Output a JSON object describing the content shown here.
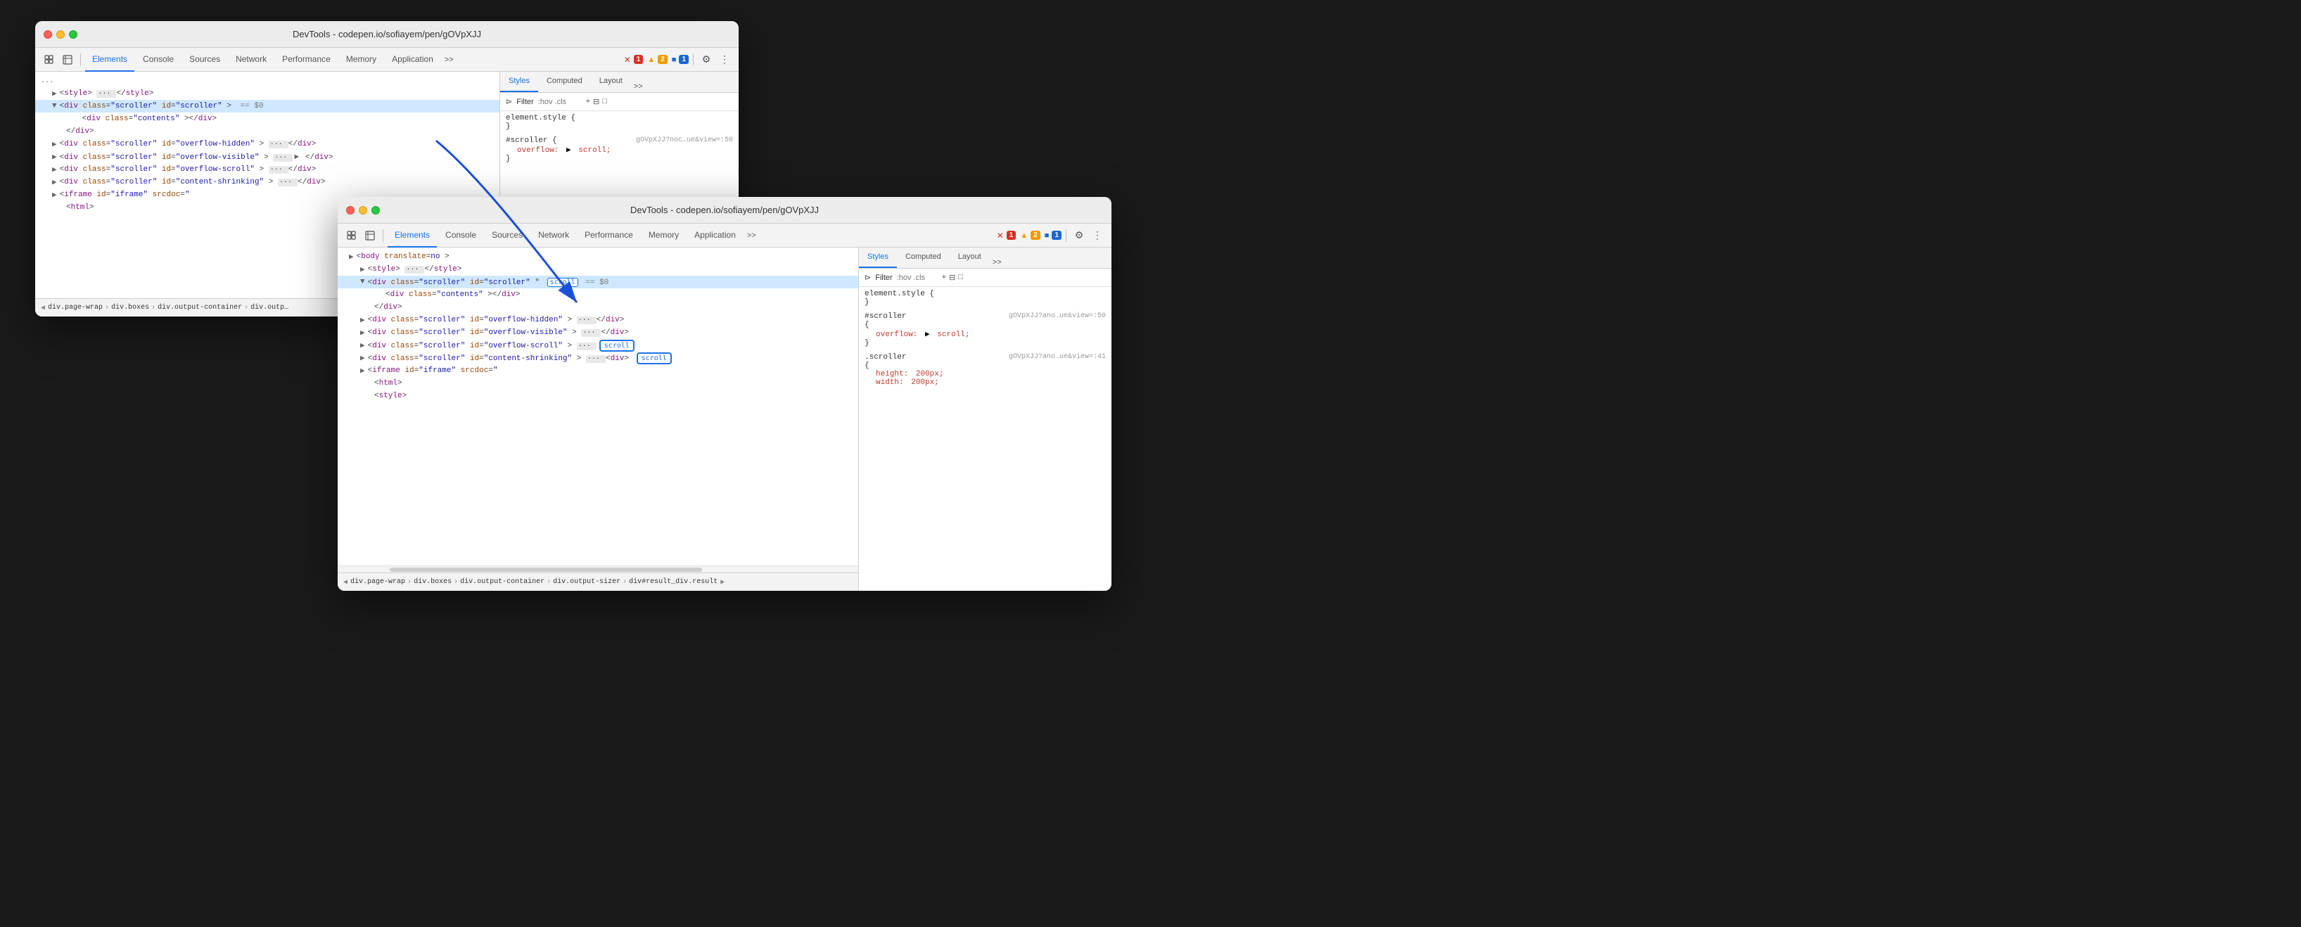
{
  "window1": {
    "title": "DevTools - codepen.io/sofiayem/pen/gOVpXJJ",
    "toolbar": {
      "tabs": [
        "Elements",
        "Console",
        "Sources",
        "Network",
        "Performance",
        "Memory",
        "Application"
      ],
      "active_tab": "Elements",
      "more_label": ">>",
      "badges": {
        "error": "1",
        "warning": "2",
        "info": "1"
      }
    },
    "elements": {
      "rows": [
        {
          "indent": 0,
          "content": "<style> ··· </style>",
          "selected": false
        },
        {
          "indent": 1,
          "content": "<div class=\"scroller\" id=\"scroller\"> == $0",
          "selected": true
        },
        {
          "indent": 2,
          "content": "<div class=\"contents\"></div>",
          "selected": false
        },
        {
          "indent": 1,
          "content": "</div>",
          "selected": false
        },
        {
          "indent": 1,
          "content": "<div class=\"scroller\" id=\"overflow-hidden\"> ··· </div>",
          "selected": false
        },
        {
          "indent": 1,
          "content": "<div class=\"scroller\" id=\"overflow-visible\"> ··· </div>",
          "selected": false
        },
        {
          "indent": 1,
          "content": "<div class=\"scroller\" id=\"overflow-scroll\"> ··· </div>",
          "selected": false
        },
        {
          "indent": 1,
          "content": "<div class=\"scroller\" id=\"content-shrinking\"> ··· </div>",
          "selected": false
        },
        {
          "indent": 1,
          "content": "<iframe id=\"iframe\" srcdoc=\"",
          "selected": false
        },
        {
          "indent": 2,
          "content": "<html>",
          "selected": false
        }
      ]
    },
    "styles": {
      "tabs": [
        "Styles",
        "Computed",
        "Layout"
      ],
      "active_tab": "Styles",
      "filter_placeholder": ":hov .cls",
      "rules": [
        {
          "selector": "element.style {",
          "source": "",
          "properties": [],
          "close": "}"
        },
        {
          "selector": "#scroller {",
          "source": "gOVpXJJ?noc…ue&view=:50",
          "properties": [
            {
              "name": "overflow:",
              "arrow": "▶",
              "value": "scroll;"
            }
          ],
          "close": "}"
        }
      ]
    },
    "breadcrumb": {
      "items": [
        "div.page-wrap",
        "div.boxes",
        "div.output-container",
        "div.outp…"
      ]
    }
  },
  "window2": {
    "title": "DevTools - codepen.io/sofiayem/pen/gOVpXJJ",
    "toolbar": {
      "tabs": [
        "Elements",
        "Console",
        "Sources",
        "Network",
        "Performance",
        "Memory",
        "Application"
      ],
      "active_tab": "Elements",
      "more_label": ">>",
      "badges": {
        "error": "1",
        "warning": "2",
        "info": "1"
      }
    },
    "elements": {
      "rows": [
        {
          "indent": 0,
          "content": "<body translate=no >",
          "selected": false
        },
        {
          "indent": 1,
          "content": "<style> ··· </style>",
          "selected": false
        },
        {
          "indent": 2,
          "content": "<div class=\"scroller\" id=\"scroller\"",
          "has_scroll_badge": true,
          "badge_text": "scroll",
          "suffix": "== $0",
          "selected": true
        },
        {
          "indent": 3,
          "content": "<div class=\"contents\"></div>",
          "selected": false
        },
        {
          "indent": 2,
          "content": "</div>",
          "selected": false
        },
        {
          "indent": 2,
          "content": "<div class=\"scroller\" id=\"overflow-hidden\"> ··· </div>",
          "selected": false
        },
        {
          "indent": 2,
          "content": "<div class=\"scroller\" id=\"overflow-visible\"> ··· </div>",
          "selected": false
        },
        {
          "indent": 2,
          "content": "<div class=\"scroller\" id=\"overflow-scroll\"> ···",
          "has_scroll_badge2": true,
          "badge2_text": "scroll",
          "selected": false
        },
        {
          "indent": 2,
          "content": "<div class=\"scroller\" id=\"content-shrinking\"> ···",
          "has_scroll_badge3": true,
          "badge3_text": "scroll",
          "selected": false
        },
        {
          "indent": 2,
          "content": "<iframe id=\"iframe\" srcdoc=\"",
          "selected": false
        },
        {
          "indent": 3,
          "content": "<html>",
          "selected": false
        },
        {
          "indent": 3,
          "content": "<style>",
          "selected": false
        }
      ]
    },
    "styles": {
      "tabs": [
        "Styles",
        "Computed",
        "Layout"
      ],
      "active_tab": "Styles",
      "filter_placeholder": ":hov .cls",
      "rules": [
        {
          "selector": "element.style {",
          "source": "",
          "properties": [],
          "close": "}"
        },
        {
          "selector": "#scroller",
          "source": "gOVpXJJ?ano…ue&view=:50",
          "open_brace": "{",
          "properties": [
            {
              "name": "overflow:",
              "arrow": "▶",
              "value": "scroll;"
            }
          ],
          "close": "}"
        },
        {
          "selector": ".scroller",
          "source": "gOVpXJJ?ano…ue&view=:41",
          "open_brace": "{",
          "properties": [
            {
              "name": "height:",
              "value": "200px;"
            },
            {
              "name": "width:",
              "value": "200px;"
            }
          ],
          "close": ""
        }
      ]
    },
    "breadcrumb": {
      "items": [
        "div.page-wrap",
        "div.boxes",
        "div.output-container",
        "div.output-sizer",
        "div#result_div.result"
      ]
    }
  },
  "icons": {
    "cursor": "⬚",
    "inspect": "□",
    "filter": "⊳",
    "plus": "+",
    "settings": "⚙",
    "more": "⋮",
    "error_symbol": "✕",
    "warning_symbol": "▲",
    "info_symbol": "■",
    "chevron_right": "▶",
    "chevron_down": "▼",
    "nav_left": "◀",
    "nav_right": "▶"
  }
}
